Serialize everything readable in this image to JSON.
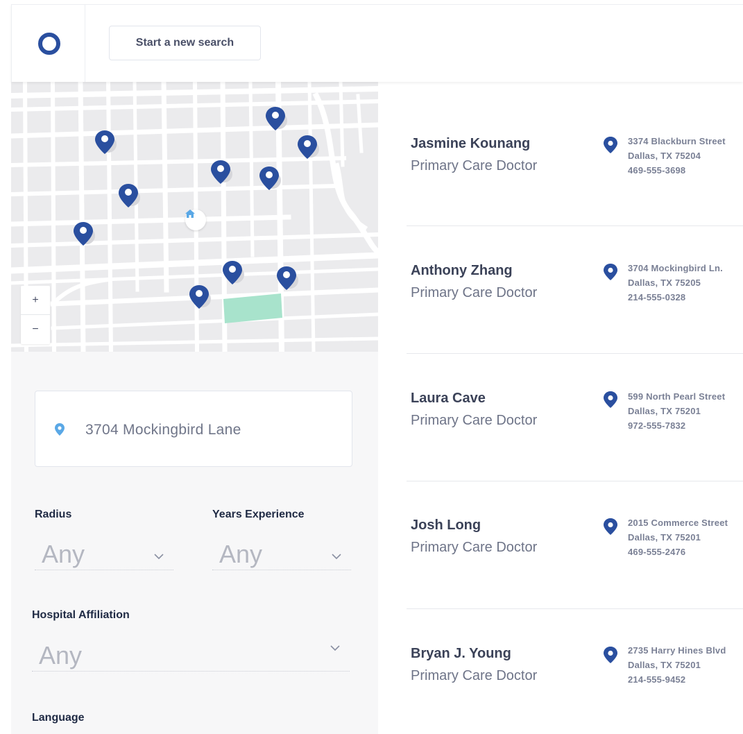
{
  "header": {
    "logo_icon": "ring-logo-icon",
    "search_button_label": "Start a new search"
  },
  "map": {
    "zoom_in": "+",
    "zoom_out": "−",
    "home_icon": "home-icon",
    "pin_icon": "map-pin-icon",
    "pin_color": "#2a4f9f",
    "park_color": "#a8e3cc"
  },
  "filters": {
    "address": {
      "value": "3704 Mockingbird Lane",
      "icon": "location-pin-icon"
    },
    "radius": {
      "label": "Radius",
      "value": "Any"
    },
    "years": {
      "label": "Years Experience",
      "value": "Any"
    },
    "hospital": {
      "label": "Hospital Affiliation",
      "value": "Any"
    },
    "language": {
      "label": "Language"
    }
  },
  "results": [
    {
      "name": "Jasmine Kounang",
      "role": "Primary Care Doctor",
      "street": "3374 Blackburn Street",
      "city": "Dallas, TX 75204",
      "phone": "469-555-3698"
    },
    {
      "name": "Anthony Zhang",
      "role": "Primary Care Doctor",
      "street": "3704 Mockingbird Ln.",
      "city": "Dallas, TX 75205",
      "phone": "214-555-0328"
    },
    {
      "name": "Laura Cave",
      "role": "Primary Care Doctor",
      "street": "599 North Pearl Street",
      "city": "Dallas, TX 75201",
      "phone": "972-555-7832"
    },
    {
      "name": "Josh Long",
      "role": "Primary Care Doctor",
      "street": "2015 Commerce Street",
      "city": "Dallas, TX 75201",
      "phone": "469-555-2476"
    },
    {
      "name": "Bryan J. Young",
      "role": "Primary Care Doctor",
      "street": "2735 Harry Hines Blvd",
      "city": "Dallas, TX 75201",
      "phone": "214-555-9452"
    }
  ]
}
